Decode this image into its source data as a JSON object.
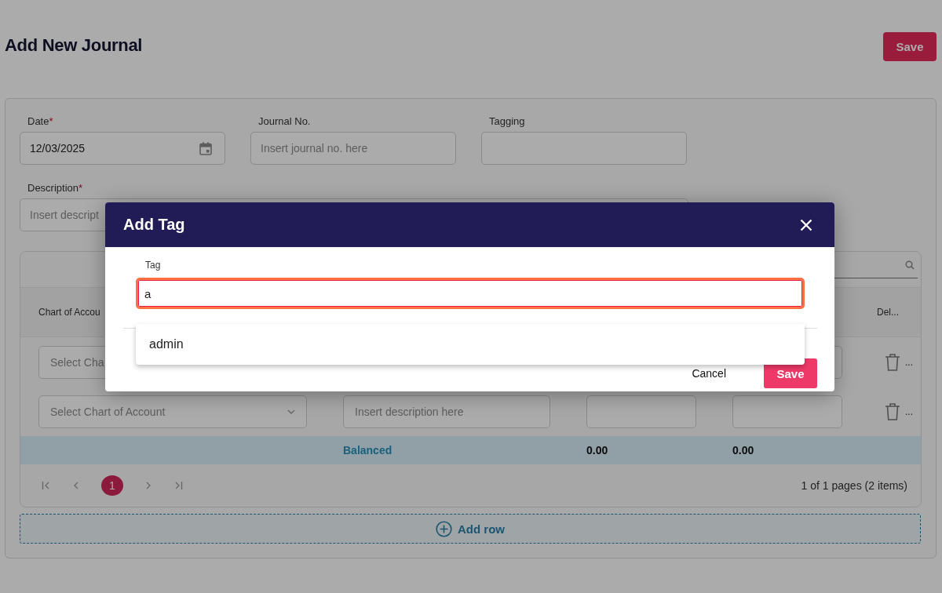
{
  "page": {
    "title": "Add New Journal",
    "save_button": "Save"
  },
  "form": {
    "fields": [
      {
        "label": "Date",
        "required_mark": "*",
        "kind": "date",
        "value": "12/03/2025"
      },
      {
        "label": "Journal No.",
        "kind": "text",
        "placeholder": "Insert journal no. here"
      },
      {
        "label": "Tagging",
        "kind": "text"
      }
    ],
    "description": {
      "label": "Description",
      "required_mark": "*",
      "placeholder": "Insert descript"
    }
  },
  "table": {
    "columns": [
      {
        "label": "Chart of Accou"
      },
      {
        "label": "Del..."
      }
    ],
    "rows": [
      {
        "account_placeholder": "Select Cha",
        "action": "..."
      },
      {
        "account_placeholder": "Select Chart of Account",
        "description_placeholder": "Insert description here",
        "action": "..."
      }
    ],
    "totals": {
      "label": "Balanced",
      "debit": "0.00",
      "credit": "0.00"
    },
    "pagination": {
      "pages": [
        {
          "label": "1",
          "selected": true
        }
      ],
      "summary": "1 of 1 pages (2 items)"
    }
  },
  "add_row": "Add row",
  "modal": {
    "title": "Add Tag",
    "field": {
      "label": "Tag",
      "value": "a",
      "focused": true
    },
    "suggestions": [
      {
        "label": "admin"
      }
    ],
    "buttons": [
      {
        "kind": "cancel",
        "label": "Cancel"
      },
      {
        "kind": "save",
        "label": "Save"
      }
    ]
  }
}
